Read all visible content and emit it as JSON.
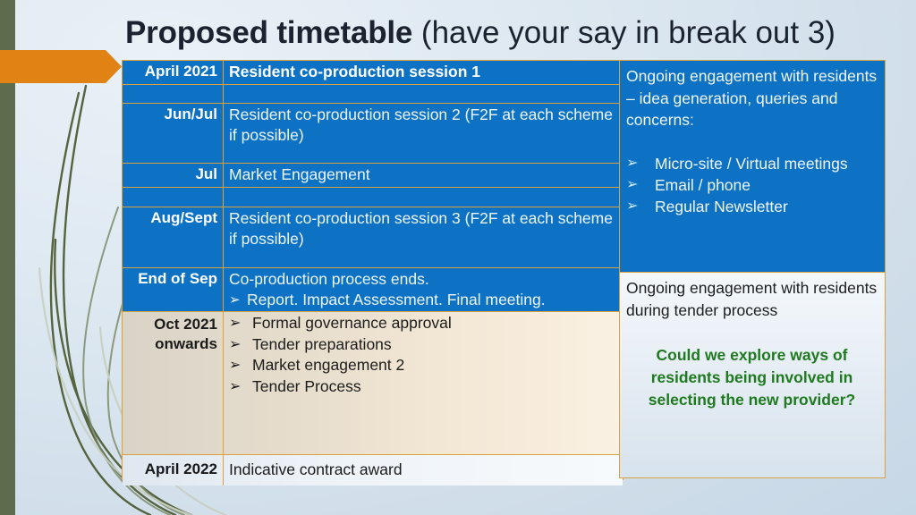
{
  "slide": {
    "title_bold": "Proposed timetable",
    "title_light": " (have your say in break out 3)",
    "decor": {
      "left_band_color": "#5d6c4c",
      "arrow_color": "#e08214",
      "arrow_label": "orange-banner-arrow",
      "grass_color": "#55633f",
      "background_color": "#dce7f0"
    }
  },
  "table": {
    "border_color": "#d9a13f",
    "blue_color": "#0d72c4",
    "rows": [
      {
        "date": "April 2021",
        "body": "Resident co-production session 1",
        "style": "blue-bold"
      },
      {
        "date": "",
        "body": "",
        "style": "blue-spacer"
      },
      {
        "date": "Jun/Jul",
        "body": "Resident co-production session 2 (F2F at each scheme if possible)",
        "style": "blue"
      },
      {
        "date": "Jul",
        "body": "Market Engagement",
        "style": "blue"
      },
      {
        "date": "",
        "body": "",
        "style": "blue-spacer"
      },
      {
        "date": "Aug/Sept",
        "body": "Resident co-production session 3 (F2F at each scheme if possible)",
        "style": "blue"
      },
      {
        "date": "End of Sep",
        "body": "Co-production process ends.",
        "sub_bullet": "Report. Impact Assessment. Final meeting.",
        "style": "blue"
      },
      {
        "date": "Oct 2021 onwards",
        "date_line1": "Oct 2021",
        "date_line2": "onwards",
        "bullets": [
          "Formal governance approval",
          "Tender preparations",
          "Market engagement 2",
          "Tender Process"
        ],
        "style": "beige"
      },
      {
        "date": "April 2022",
        "body": "Indicative contract award",
        "style": "light"
      }
    ]
  },
  "right_panel_top": {
    "intro": "Ongoing engagement with residents – idea generation, queries and concerns:",
    "bullets": [
      "Micro-site / Virtual meetings",
      "Email / phone",
      "Regular Newsletter"
    ]
  },
  "right_panel_bottom": {
    "intro": "Ongoing engagement with residents during tender process",
    "question": "Could we explore ways of residents being involved in selecting the new provider?",
    "question_color": "#1f7a1f"
  },
  "icons": {
    "bullet_arrow": "➢"
  }
}
